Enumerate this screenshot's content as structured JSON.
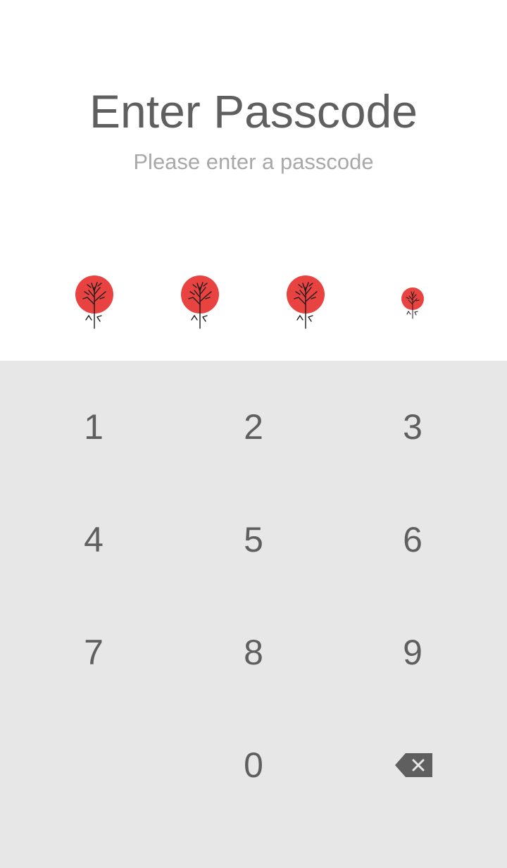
{
  "title": "Enter Passcode",
  "subtitle": "Please enter a passcode",
  "passcode_indicator": {
    "length": 4,
    "filled": 3,
    "dot_color": "#e84340",
    "icon": "red-tree-circle-icon"
  },
  "keypad": {
    "keys": [
      "1",
      "2",
      "3",
      "4",
      "5",
      "6",
      "7",
      "8",
      "9",
      "",
      "0"
    ],
    "backspace_icon": "backspace-icon"
  },
  "colors": {
    "keypad_background": "#e7e7e7",
    "text": "#5f5f5f",
    "subtitle": "#a8a8a8"
  }
}
